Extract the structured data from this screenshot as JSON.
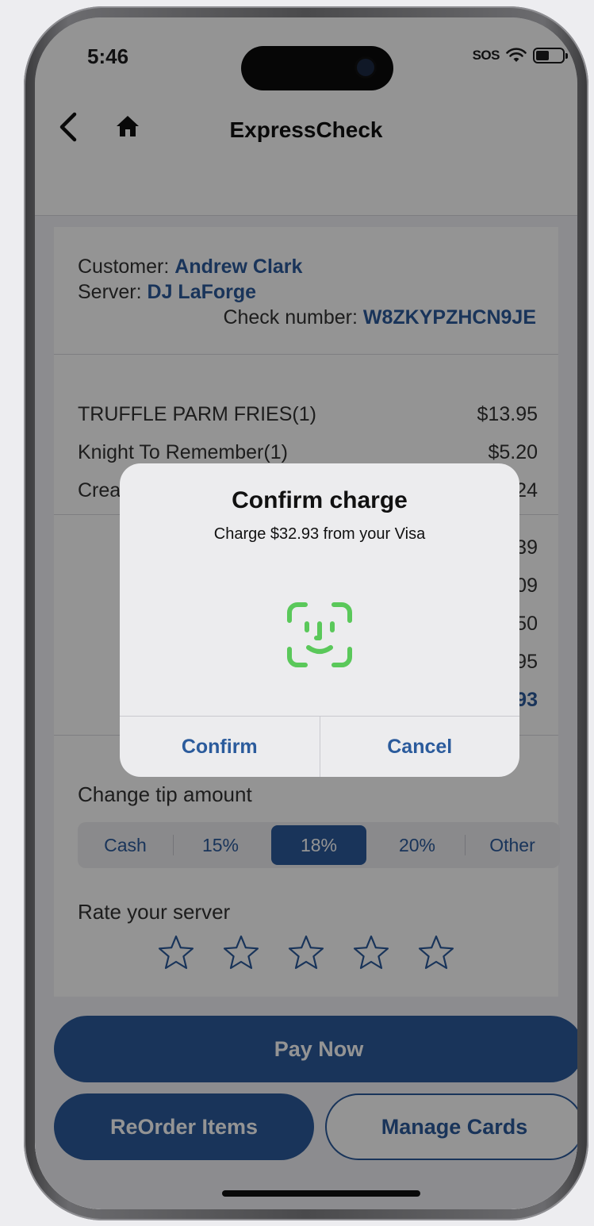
{
  "status_bar": {
    "time": "5:46",
    "sos": "SOS"
  },
  "nav": {
    "title": "ExpressCheck"
  },
  "check": {
    "customer_label": "Customer: ",
    "customer_name": "Andrew Clark",
    "server_label": "Server: ",
    "server_name": "DJ LaForge",
    "check_label": "Check number: ",
    "check_number": "W8ZKYPZHCN9JE"
  },
  "items": [
    {
      "name": "TRUFFLE PARM FRIES(1)",
      "price": "$13.95"
    },
    {
      "name": "Knight To Remember(1)",
      "price": "$5.20"
    },
    {
      "name": "Crea",
      "price": "6.24"
    }
  ],
  "totals": [
    {
      "value": "5.39"
    },
    {
      "value": "2.09"
    },
    {
      "value": "0.50"
    },
    {
      "value": "4.95"
    },
    {
      "value": "2.93"
    }
  ],
  "tip": {
    "label": "Change tip amount",
    "options": [
      "Cash",
      "15%",
      "18%",
      "20%",
      "Other"
    ],
    "selected": "18%"
  },
  "rating": {
    "label": "Rate your server",
    "stars_total": 5,
    "stars_filled": 0
  },
  "buttons": {
    "pay": "Pay Now",
    "reorder": "ReOrder Items",
    "manage": "Manage Cards"
  },
  "alert": {
    "title": "Confirm charge",
    "message": "Charge $32.93 from your Visa",
    "confirm": "Confirm",
    "cancel": "Cancel"
  },
  "colors": {
    "accent": "#2b5b9c",
    "faceid": "#5ac85a"
  },
  "icons": [
    "back-chevron-icon",
    "home-icon",
    "wifi-icon",
    "battery-icon",
    "star-icon",
    "face-id-icon"
  ]
}
